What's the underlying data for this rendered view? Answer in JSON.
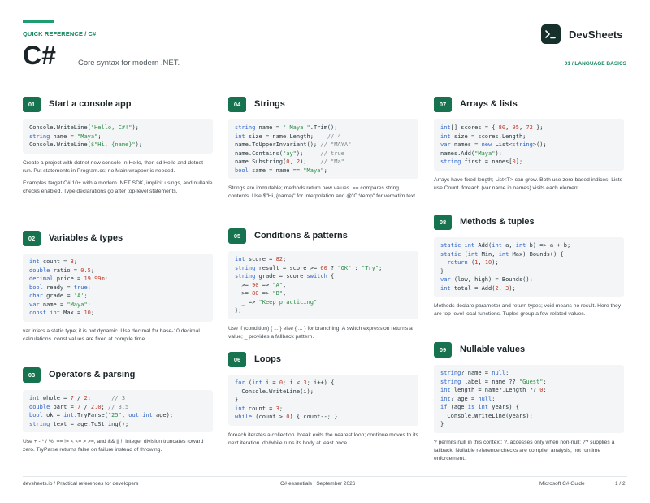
{
  "header": {
    "kicker": "QUICK REFERENCE / C#",
    "title": "C#",
    "subtitle": "Core syntax for modern .NET.",
    "brand": "DevSheets",
    "page_tag": "01 / LANGUAGE BASICS"
  },
  "colors": {
    "accent": "#17734f",
    "rule": "#1f9d6e",
    "keyword": "#2d63c8",
    "string": "#2e8b47",
    "number": "#c0392b",
    "comment": "#7c8589"
  },
  "icons": {
    "brand": "terminal-prompt-icon"
  },
  "sections": [
    {
      "num": "01",
      "title": "Start a console app",
      "code": [
        [
          [
            "Console.WriteLine(",
            ""
          ],
          [
            "\"Hello, C#!\"",
            "s"
          ],
          [
            ");",
            ""
          ]
        ],
        [
          [
            "string",
            "k"
          ],
          [
            " name = ",
            ""
          ],
          [
            "\"Maya\"",
            "s"
          ],
          [
            ";",
            ""
          ]
        ],
        [
          [
            "Console.WriteLine(",
            ""
          ],
          [
            "$\"Hi, {name}\"",
            "s"
          ],
          [
            ");",
            ""
          ]
        ]
      ],
      "desc": [
        "Create a project with dotnet new console -n Hello, then cd Hello and dotnet run. Put statements in Program.cs; no Main wrapper is needed.",
        "Examples target C# 10+ with a modern .NET SDK, implicit usings, and nullable checks enabled. Type declarations go after top-level statements."
      ]
    },
    {
      "num": "02",
      "title": "Variables & types",
      "code": [
        [
          [
            "int",
            "k"
          ],
          [
            " count = ",
            ""
          ],
          [
            "3",
            "n"
          ],
          [
            ";",
            ""
          ]
        ],
        [
          [
            "double",
            "k"
          ],
          [
            " ratio = ",
            ""
          ],
          [
            "0.5",
            "n"
          ],
          [
            ";",
            ""
          ]
        ],
        [
          [
            "decimal",
            "k"
          ],
          [
            " price = ",
            ""
          ],
          [
            "19.99m",
            "n"
          ],
          [
            ";",
            ""
          ]
        ],
        [
          [
            "bool",
            "k"
          ],
          [
            " ready = ",
            ""
          ],
          [
            "true",
            "k"
          ],
          [
            ";",
            ""
          ]
        ],
        [
          [
            "char",
            "k"
          ],
          [
            " grade = ",
            ""
          ],
          [
            "'A'",
            "s"
          ],
          [
            ";",
            ""
          ]
        ],
        [
          [
            "var",
            "k"
          ],
          [
            " name = ",
            ""
          ],
          [
            "\"Maya\"",
            "s"
          ],
          [
            ";",
            ""
          ]
        ],
        [
          [
            "const",
            "k"
          ],
          [
            " ",
            ""
          ],
          [
            "int",
            "k"
          ],
          [
            " Max = ",
            ""
          ],
          [
            "10",
            "n"
          ],
          [
            ";",
            ""
          ]
        ]
      ],
      "desc": [
        "var infers a static type; it is not dynamic. Use decimal for base-10 decimal calculations. const values are fixed at compile time."
      ]
    },
    {
      "num": "03",
      "title": "Operators & parsing",
      "code": [
        [
          [
            "int",
            "k"
          ],
          [
            " whole = ",
            ""
          ],
          [
            "7",
            "n"
          ],
          [
            " / ",
            ""
          ],
          [
            "2",
            "n"
          ],
          [
            ";      ",
            ""
          ],
          [
            "// 3",
            "c"
          ]
        ],
        [
          [
            "double",
            "k"
          ],
          [
            " part = ",
            ""
          ],
          [
            "7",
            "n"
          ],
          [
            " / ",
            ""
          ],
          [
            "2.0",
            "n"
          ],
          [
            "; ",
            ""
          ],
          [
            "// 3.5",
            "c"
          ]
        ],
        [
          [
            "bool",
            "k"
          ],
          [
            " ok = ",
            ""
          ],
          [
            "int",
            "k"
          ],
          [
            ".TryParse(",
            ""
          ],
          [
            "\"25\"",
            "s"
          ],
          [
            ", ",
            ""
          ],
          [
            "out int",
            "k"
          ],
          [
            " age);",
            ""
          ]
        ],
        [
          [
            "string",
            "k"
          ],
          [
            " text = age.ToString();",
            ""
          ]
        ]
      ],
      "desc": [
        "Use + - * / %, == != < <= > >=, and && || !. Integer division truncates toward zero. TryParse returns false on failure instead of throwing."
      ]
    },
    {
      "num": "04",
      "title": "Strings",
      "code": [
        [
          [
            "string",
            "k"
          ],
          [
            " name = ",
            ""
          ],
          [
            "\" Maya \"",
            "s"
          ],
          [
            ".Trim();",
            ""
          ]
        ],
        [
          [
            "int",
            "k"
          ],
          [
            " size = name.Length;    ",
            ""
          ],
          [
            "// 4",
            "c"
          ]
        ],
        [
          [
            "name.ToUpperInvariant(); ",
            ""
          ],
          [
            "// \"MAYA\"",
            "c"
          ]
        ],
        [
          [
            "name.Contains(",
            ""
          ],
          [
            "\"ay\"",
            "s"
          ],
          [
            ");     ",
            ""
          ],
          [
            "// true",
            "c"
          ]
        ],
        [
          [
            "name.Substring(",
            ""
          ],
          [
            "0",
            "n"
          ],
          [
            ", ",
            ""
          ],
          [
            "2",
            "n"
          ],
          [
            ");    ",
            ""
          ],
          [
            "// \"Ma\"",
            "c"
          ]
        ],
        [
          [
            "bool",
            "k"
          ],
          [
            " same = name == ",
            ""
          ],
          [
            "\"Maya\"",
            "s"
          ],
          [
            ";",
            ""
          ]
        ]
      ],
      "desc": [
        "Strings are immutable; methods return new values. == compares string contents. Use $\"Hi, {name}\" for interpolation and @\"C:\\temp\" for verbatim text."
      ]
    },
    {
      "num": "05",
      "title": "Conditions & patterns",
      "code": [
        [
          [
            "int",
            "k"
          ],
          [
            " score = ",
            ""
          ],
          [
            "82",
            "n"
          ],
          [
            ";",
            ""
          ]
        ],
        [
          [
            "string",
            "k"
          ],
          [
            " result = score >= ",
            ""
          ],
          [
            "60",
            "n"
          ],
          [
            " ? ",
            ""
          ],
          [
            "\"OK\"",
            "s"
          ],
          [
            " : ",
            ""
          ],
          [
            "\"Try\"",
            "s"
          ],
          [
            ";",
            ""
          ]
        ],
        [
          [
            "string",
            "k"
          ],
          [
            " grade = score ",
            ""
          ],
          [
            "switch",
            "k"
          ],
          [
            " {",
            ""
          ]
        ],
        [
          [
            "  >= ",
            ""
          ],
          [
            "90",
            "n"
          ],
          [
            " => ",
            ""
          ],
          [
            "\"A\"",
            "s"
          ],
          [
            ",",
            ""
          ]
        ],
        [
          [
            "  >= ",
            ""
          ],
          [
            "80",
            "n"
          ],
          [
            " => ",
            ""
          ],
          [
            "\"B\"",
            "s"
          ],
          [
            ",",
            ""
          ]
        ],
        [
          [
            "  _ => ",
            ""
          ],
          [
            "\"Keep practicing\"",
            "s"
          ]
        ],
        [
          [
            "};",
            ""
          ]
        ]
      ],
      "desc": [
        "Use if (condition) { ... } else { ... } for branching. A switch expression returns a value; _ provides a fallback pattern."
      ]
    },
    {
      "num": "06",
      "title": "Loops",
      "code": [
        [
          [
            "for",
            "k"
          ],
          [
            " (",
            ""
          ],
          [
            "int",
            "k"
          ],
          [
            " i = ",
            ""
          ],
          [
            "0",
            "n"
          ],
          [
            "; i < ",
            ""
          ],
          [
            "3",
            "n"
          ],
          [
            "; i++) {",
            ""
          ]
        ],
        [
          [
            "  Console.WriteLine(i);",
            ""
          ]
        ],
        [
          [
            "}",
            ""
          ]
        ],
        [
          [
            "int",
            "k"
          ],
          [
            " count = ",
            ""
          ],
          [
            "3",
            "n"
          ],
          [
            ";",
            ""
          ]
        ],
        [
          [
            "while",
            "k"
          ],
          [
            " (count > ",
            ""
          ],
          [
            "0",
            "n"
          ],
          [
            ") { count--; }",
            ""
          ]
        ]
      ],
      "desc": [
        "foreach iterates a collection. break exits the nearest loop; continue moves to its next iteration. do/while runs its body at least once."
      ]
    },
    {
      "num": "07",
      "title": "Arrays & lists",
      "code": [
        [
          [
            "int",
            "k"
          ],
          [
            "[] scores = { ",
            ""
          ],
          [
            "80",
            "n"
          ],
          [
            ", ",
            ""
          ],
          [
            "95",
            "n"
          ],
          [
            ", ",
            ""
          ],
          [
            "72",
            "n"
          ],
          [
            " };",
            ""
          ]
        ],
        [
          [
            "int",
            "k"
          ],
          [
            " size = scores.Length;",
            ""
          ]
        ],
        [
          [
            "var",
            "k"
          ],
          [
            " names = ",
            ""
          ],
          [
            "new",
            "k"
          ],
          [
            " List<",
            ""
          ],
          [
            "string",
            "k"
          ],
          [
            ">();",
            ""
          ]
        ],
        [
          [
            "names.Add(",
            ""
          ],
          [
            "\"Maya\"",
            "s"
          ],
          [
            ");",
            ""
          ]
        ],
        [
          [
            "string",
            "k"
          ],
          [
            " first = names[",
            ""
          ],
          [
            "0",
            "n"
          ],
          [
            "];",
            ""
          ]
        ]
      ],
      "desc": [
        "Arrays have fixed length; List<T> can grow. Both use zero-based indices. Lists use Count. foreach (var name in names) visits each element."
      ]
    },
    {
      "num": "08",
      "title": "Methods & tuples",
      "code": [
        [
          [
            "static int",
            "k"
          ],
          [
            " Add(",
            ""
          ],
          [
            "int",
            "k"
          ],
          [
            " a, ",
            ""
          ],
          [
            "int",
            "k"
          ],
          [
            " b) => a + b;",
            ""
          ]
        ],
        [
          [
            "static",
            "k"
          ],
          [
            " (",
            ""
          ],
          [
            "int",
            "k"
          ],
          [
            " Min, ",
            ""
          ],
          [
            "int",
            "k"
          ],
          [
            " Max) Bounds() {",
            ""
          ]
        ],
        [
          [
            "  ",
            ""
          ],
          [
            "return",
            "k"
          ],
          [
            " (",
            ""
          ],
          [
            "1",
            "n"
          ],
          [
            ", ",
            ""
          ],
          [
            "10",
            "n"
          ],
          [
            ");",
            ""
          ]
        ],
        [
          [
            "}",
            ""
          ]
        ],
        [
          [
            "var",
            "k"
          ],
          [
            " (low, high) = Bounds();",
            ""
          ]
        ],
        [
          [
            "int",
            "k"
          ],
          [
            " total = Add(",
            ""
          ],
          [
            "2",
            "n"
          ],
          [
            ", ",
            ""
          ],
          [
            "3",
            "n"
          ],
          [
            ");",
            ""
          ]
        ]
      ],
      "desc": [
        "Methods declare parameter and return types; void means no result. Here they are top-level local functions. Tuples group a few related values."
      ]
    },
    {
      "num": "09",
      "title": "Nullable values",
      "code": [
        [
          [
            "string",
            "k"
          ],
          [
            "? name = ",
            ""
          ],
          [
            "null",
            "k"
          ],
          [
            ";",
            ""
          ]
        ],
        [
          [
            "string",
            "k"
          ],
          [
            " label = name ?? ",
            ""
          ],
          [
            "\"Guest\"",
            "s"
          ],
          [
            ";",
            ""
          ]
        ],
        [
          [
            "int",
            "k"
          ],
          [
            " length = name?.Length ?? ",
            ""
          ],
          [
            "0",
            "n"
          ],
          [
            ";",
            ""
          ]
        ],
        [
          [
            "int",
            "k"
          ],
          [
            "? age = ",
            ""
          ],
          [
            "null",
            "k"
          ],
          [
            ";",
            ""
          ]
        ],
        [
          [
            "if",
            "k"
          ],
          [
            " (age ",
            ""
          ],
          [
            "is int",
            "k"
          ],
          [
            " years) {",
            ""
          ]
        ],
        [
          [
            "  Console.WriteLine(years);",
            ""
          ]
        ],
        [
          [
            "}",
            ""
          ]
        ]
      ],
      "desc": [
        "? permits null in this context; ?. accesses only when non-null; ?? supplies a fallback. Nullable reference checks are compiler analysis, not runtime enforcement."
      ]
    }
  ],
  "footer": {
    "left": "devsheets.io  /  Practical references for developers",
    "middle": "C# essentials  |  September 2026",
    "right": "Microsoft C# Guide",
    "page": "1 / 2"
  }
}
